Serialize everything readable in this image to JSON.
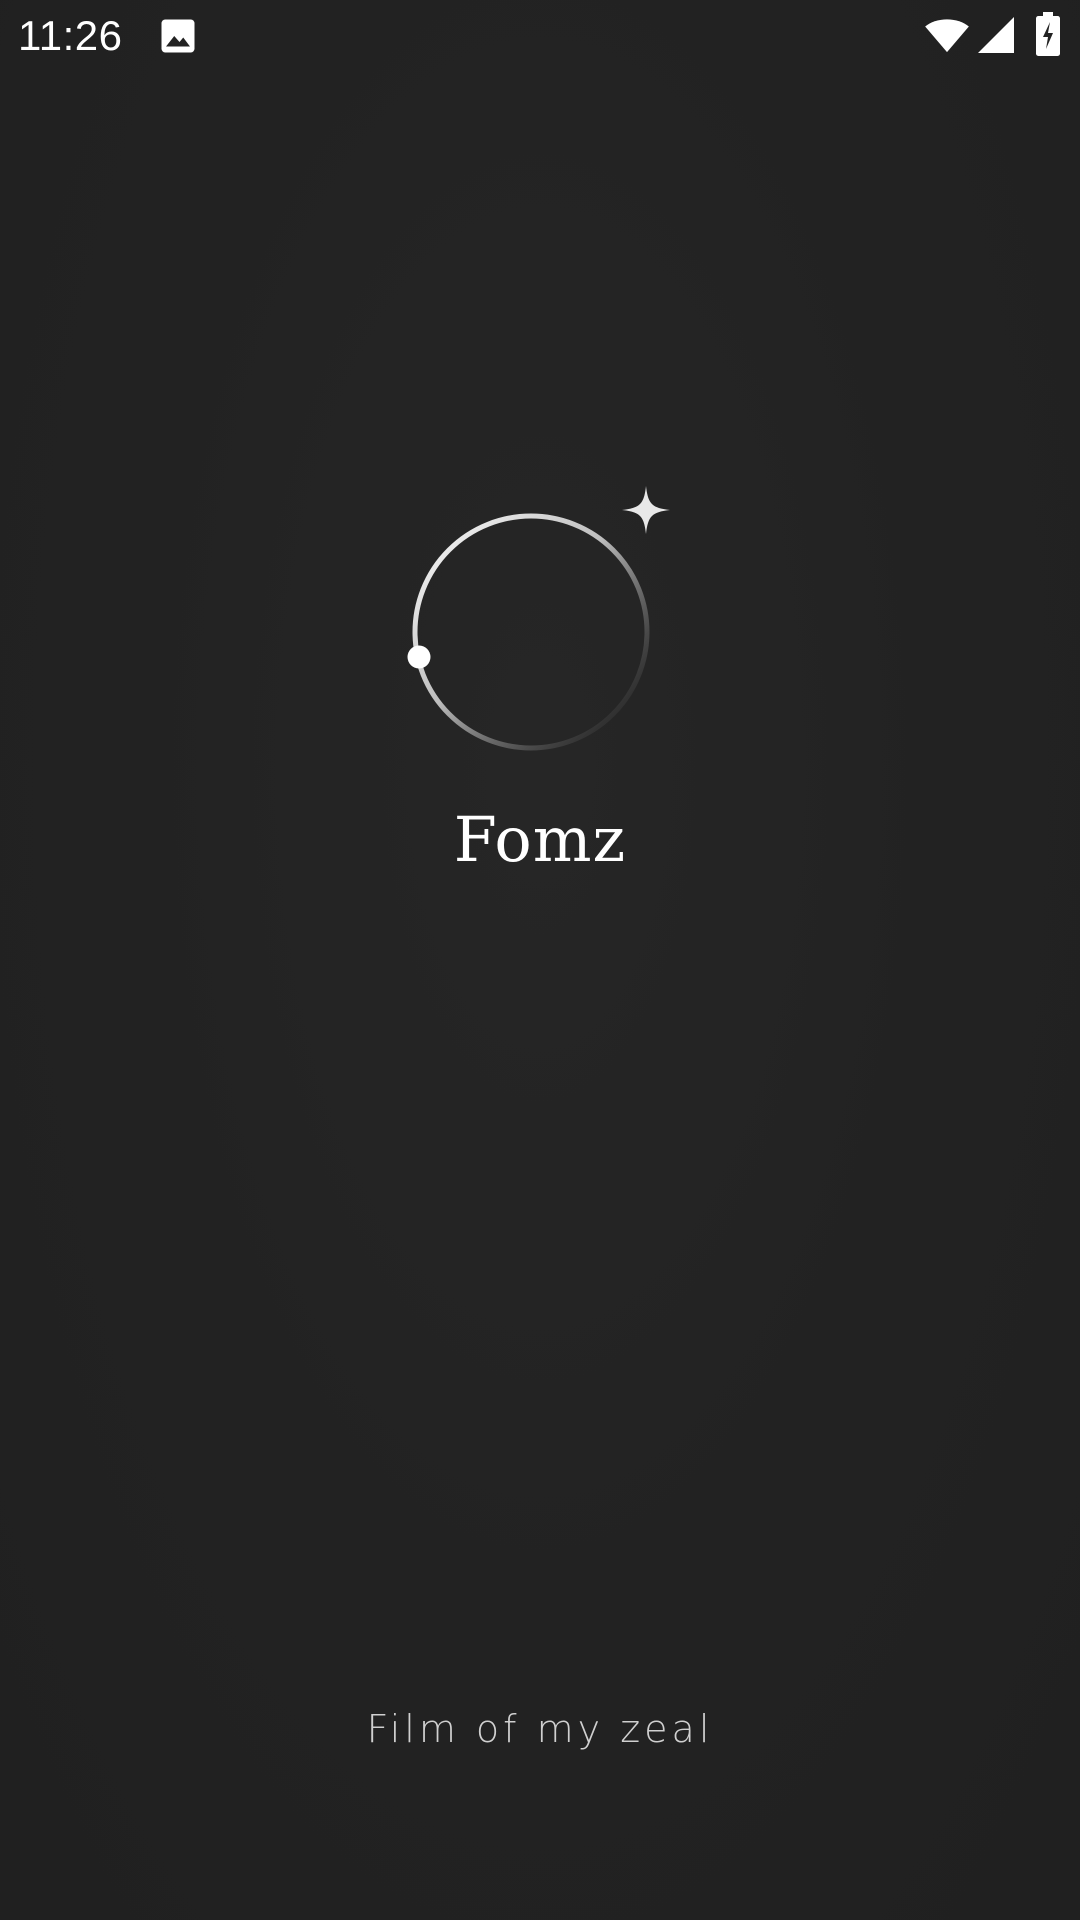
{
  "status_bar": {
    "time": "11:26",
    "icons": [
      "gallery-icon",
      "wifi-icon",
      "cell-signal-icon",
      "battery-charging-icon"
    ]
  },
  "splash": {
    "app_name": "Fomz",
    "tagline": "Film of my zeal",
    "logo_icon": "orbit-ring-with-sparkle-icon"
  },
  "colors": {
    "background": "#222222",
    "text": "#ffffff",
    "tagline": "#d0d0d0"
  }
}
